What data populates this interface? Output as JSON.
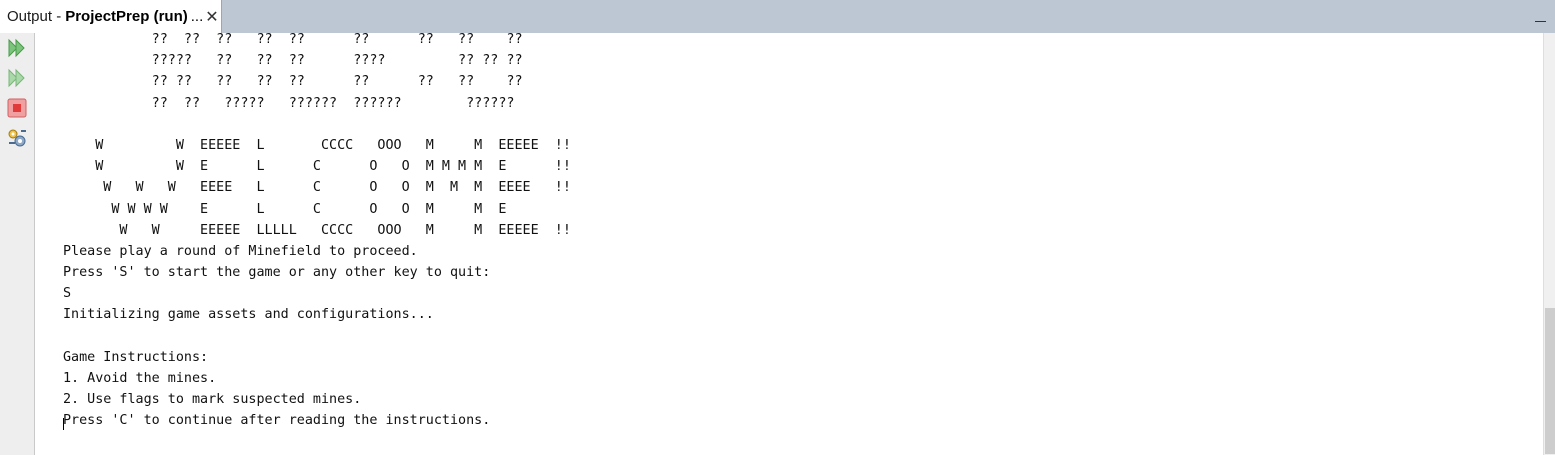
{
  "tab": {
    "prefix": "Output -",
    "name": "ProjectPrep (run)",
    "ellipsis": "...",
    "close": "✕"
  },
  "toolbar": {
    "icons": [
      "rerun-icon",
      "rerun-with-different-params-icon",
      "stop-icon",
      "output-settings-icon"
    ]
  },
  "output": {
    "lines": [
      "           ??  ??  ??   ??  ??      ??      ??   ??    ??",
      "           ?????   ??   ??  ??      ????         ?? ?? ??",
      "           ?? ??   ??   ??  ??      ??      ??   ??    ??",
      "           ??  ??   ?????   ??????  ??????        ??????",
      "",
      "    W         W  EEEEE  L       CCCC   OOO   M     M  EEEEE  !!",
      "    W         W  E      L      C      O   O  M M M M  E      !!",
      "     W   W   W   EEEE   L      C      O   O  M  M  M  EEEE   !!",
      "      W W W W    E      L      C      O   O  M     M  E",
      "       W   W     EEEEE  LLLLL   CCCC   OOO   M     M  EEEEE  !!",
      "Please play a round of Minefield to proceed.",
      "Press 'S' to start the game or any other key to quit:",
      "S",
      "Initializing game assets and configurations...",
      "",
      "Game Instructions:",
      "1. Avoid the mines.",
      "2. Use flags to mark suspected mines.",
      "Press 'C' to continue after reading the instructions."
    ]
  },
  "colors": {
    "tabbar_bg": "#bcc7d3",
    "toolbar_bg": "#eeeeee",
    "run_icon": "#6fbf6f",
    "stop_icon": "#e05050"
  }
}
